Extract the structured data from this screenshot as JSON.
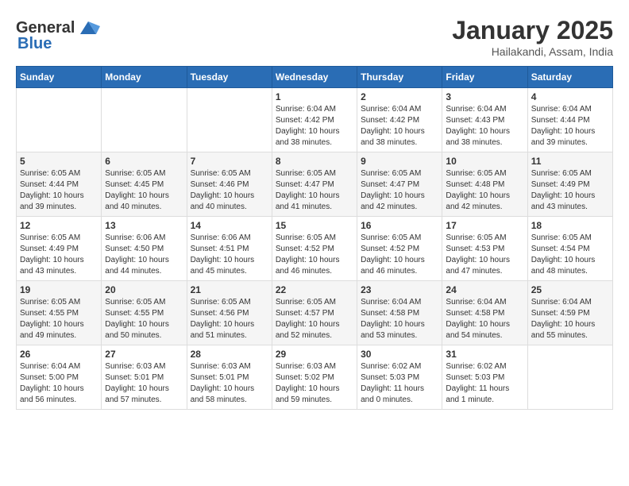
{
  "header": {
    "logo_general": "General",
    "logo_blue": "Blue",
    "month": "January 2025",
    "location": "Hailakandi, Assam, India"
  },
  "weekdays": [
    "Sunday",
    "Monday",
    "Tuesday",
    "Wednesday",
    "Thursday",
    "Friday",
    "Saturday"
  ],
  "weeks": [
    [
      {
        "day": "",
        "info": ""
      },
      {
        "day": "",
        "info": ""
      },
      {
        "day": "",
        "info": ""
      },
      {
        "day": "1",
        "info": "Sunrise: 6:04 AM\nSunset: 4:42 PM\nDaylight: 10 hours\nand 38 minutes."
      },
      {
        "day": "2",
        "info": "Sunrise: 6:04 AM\nSunset: 4:42 PM\nDaylight: 10 hours\nand 38 minutes."
      },
      {
        "day": "3",
        "info": "Sunrise: 6:04 AM\nSunset: 4:43 PM\nDaylight: 10 hours\nand 38 minutes."
      },
      {
        "day": "4",
        "info": "Sunrise: 6:04 AM\nSunset: 4:44 PM\nDaylight: 10 hours\nand 39 minutes."
      }
    ],
    [
      {
        "day": "5",
        "info": "Sunrise: 6:05 AM\nSunset: 4:44 PM\nDaylight: 10 hours\nand 39 minutes."
      },
      {
        "day": "6",
        "info": "Sunrise: 6:05 AM\nSunset: 4:45 PM\nDaylight: 10 hours\nand 40 minutes."
      },
      {
        "day": "7",
        "info": "Sunrise: 6:05 AM\nSunset: 4:46 PM\nDaylight: 10 hours\nand 40 minutes."
      },
      {
        "day": "8",
        "info": "Sunrise: 6:05 AM\nSunset: 4:47 PM\nDaylight: 10 hours\nand 41 minutes."
      },
      {
        "day": "9",
        "info": "Sunrise: 6:05 AM\nSunset: 4:47 PM\nDaylight: 10 hours\nand 42 minutes."
      },
      {
        "day": "10",
        "info": "Sunrise: 6:05 AM\nSunset: 4:48 PM\nDaylight: 10 hours\nand 42 minutes."
      },
      {
        "day": "11",
        "info": "Sunrise: 6:05 AM\nSunset: 4:49 PM\nDaylight: 10 hours\nand 43 minutes."
      }
    ],
    [
      {
        "day": "12",
        "info": "Sunrise: 6:05 AM\nSunset: 4:49 PM\nDaylight: 10 hours\nand 43 minutes."
      },
      {
        "day": "13",
        "info": "Sunrise: 6:06 AM\nSunset: 4:50 PM\nDaylight: 10 hours\nand 44 minutes."
      },
      {
        "day": "14",
        "info": "Sunrise: 6:06 AM\nSunset: 4:51 PM\nDaylight: 10 hours\nand 45 minutes."
      },
      {
        "day": "15",
        "info": "Sunrise: 6:05 AM\nSunset: 4:52 PM\nDaylight: 10 hours\nand 46 minutes."
      },
      {
        "day": "16",
        "info": "Sunrise: 6:05 AM\nSunset: 4:52 PM\nDaylight: 10 hours\nand 46 minutes."
      },
      {
        "day": "17",
        "info": "Sunrise: 6:05 AM\nSunset: 4:53 PM\nDaylight: 10 hours\nand 47 minutes."
      },
      {
        "day": "18",
        "info": "Sunrise: 6:05 AM\nSunset: 4:54 PM\nDaylight: 10 hours\nand 48 minutes."
      }
    ],
    [
      {
        "day": "19",
        "info": "Sunrise: 6:05 AM\nSunset: 4:55 PM\nDaylight: 10 hours\nand 49 minutes."
      },
      {
        "day": "20",
        "info": "Sunrise: 6:05 AM\nSunset: 4:55 PM\nDaylight: 10 hours\nand 50 minutes."
      },
      {
        "day": "21",
        "info": "Sunrise: 6:05 AM\nSunset: 4:56 PM\nDaylight: 10 hours\nand 51 minutes."
      },
      {
        "day": "22",
        "info": "Sunrise: 6:05 AM\nSunset: 4:57 PM\nDaylight: 10 hours\nand 52 minutes."
      },
      {
        "day": "23",
        "info": "Sunrise: 6:04 AM\nSunset: 4:58 PM\nDaylight: 10 hours\nand 53 minutes."
      },
      {
        "day": "24",
        "info": "Sunrise: 6:04 AM\nSunset: 4:58 PM\nDaylight: 10 hours\nand 54 minutes."
      },
      {
        "day": "25",
        "info": "Sunrise: 6:04 AM\nSunset: 4:59 PM\nDaylight: 10 hours\nand 55 minutes."
      }
    ],
    [
      {
        "day": "26",
        "info": "Sunrise: 6:04 AM\nSunset: 5:00 PM\nDaylight: 10 hours\nand 56 minutes."
      },
      {
        "day": "27",
        "info": "Sunrise: 6:03 AM\nSunset: 5:01 PM\nDaylight: 10 hours\nand 57 minutes."
      },
      {
        "day": "28",
        "info": "Sunrise: 6:03 AM\nSunset: 5:01 PM\nDaylight: 10 hours\nand 58 minutes."
      },
      {
        "day": "29",
        "info": "Sunrise: 6:03 AM\nSunset: 5:02 PM\nDaylight: 10 hours\nand 59 minutes."
      },
      {
        "day": "30",
        "info": "Sunrise: 6:02 AM\nSunset: 5:03 PM\nDaylight: 11 hours\nand 0 minutes."
      },
      {
        "day": "31",
        "info": "Sunrise: 6:02 AM\nSunset: 5:03 PM\nDaylight: 11 hours\nand 1 minute."
      },
      {
        "day": "",
        "info": ""
      }
    ]
  ]
}
